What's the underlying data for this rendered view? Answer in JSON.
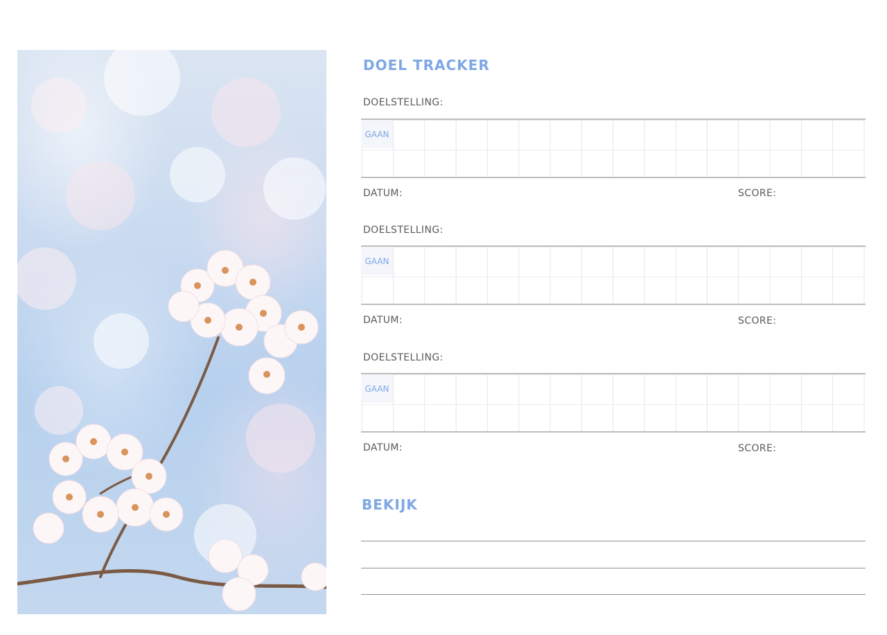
{
  "tracker": {
    "title": "DOEL TRACKER",
    "goals": [
      {
        "goal_label": "DOELSTELLING:",
        "go_label": "GAAN",
        "date_label": "DATUM:",
        "score_label": "SCORE:"
      },
      {
        "goal_label": "DOELSTELLING:",
        "go_label": "GAAN",
        "date_label": "DATUM:",
        "score_label": "SCORE:"
      },
      {
        "goal_label": "DOELSTELLING:",
        "go_label": "GAAN",
        "date_label": "DATUM:",
        "score_label": "SCORE:"
      }
    ]
  },
  "review": {
    "title": "BEKIJK",
    "lines": 3
  },
  "colors": {
    "accent": "#7ea7e6",
    "text": "#5a5a5a",
    "rule": "#bdbdbd"
  }
}
